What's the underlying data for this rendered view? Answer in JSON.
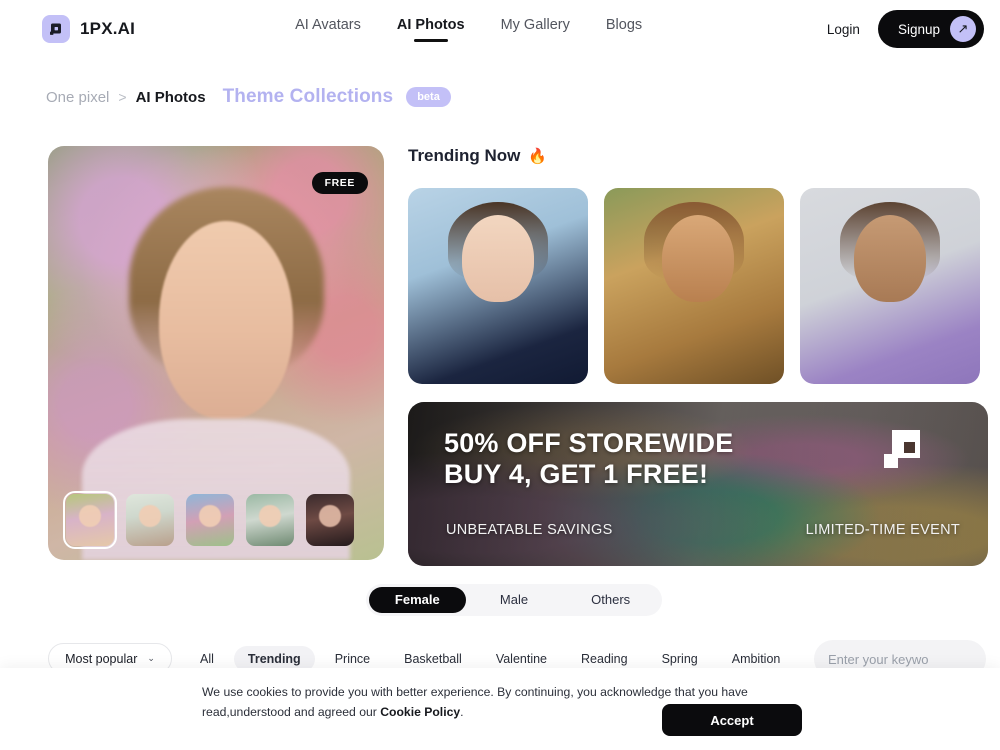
{
  "header": {
    "brand_name": "1PX.AI",
    "nav": [
      {
        "label": "AI Avatars",
        "active": false
      },
      {
        "label": "AI Photos",
        "active": true
      },
      {
        "label": "My Gallery",
        "active": false
      },
      {
        "label": "Blogs",
        "active": false
      }
    ],
    "login_label": "Login",
    "signup_label": "Signup",
    "signup_arrow": "↗",
    "accent_color": "#c3c0f7",
    "dark_color": "#0b0b0d"
  },
  "breadcrumb": {
    "root": "One pixel",
    "separator": ">",
    "current": "AI Photos",
    "theme_title": "Theme Collections",
    "beta_label": "beta"
  },
  "hero": {
    "badge": "FREE",
    "thumbnails": [
      {
        "name": "thumb-1",
        "selected": true
      },
      {
        "name": "thumb-2",
        "selected": false
      },
      {
        "name": "thumb-3",
        "selected": false
      },
      {
        "name": "thumb-4",
        "selected": false
      },
      {
        "name": "thumb-5",
        "selected": false
      }
    ]
  },
  "trending": {
    "title": "Trending Now",
    "flame_icon": "🔥",
    "cards": [
      {
        "name": "trending-card-blue"
      },
      {
        "name": "trending-card-golden"
      },
      {
        "name": "trending-card-lilac"
      }
    ]
  },
  "promo": {
    "headline_line1": "50% OFF STOREWIDE",
    "headline_line2": "BUY 4, GET 1 FREE!",
    "sub_left": "UNBEATABLE SAVINGS",
    "sub_right": "LIMITED-TIME EVENT"
  },
  "gender_toggle": {
    "options": [
      {
        "label": "Female",
        "active": true
      },
      {
        "label": "Male",
        "active": false
      },
      {
        "label": "Others",
        "active": false
      }
    ]
  },
  "filters": {
    "sort_value": "Most popular",
    "sort_chevron": "⌄",
    "chips": [
      {
        "label": "All",
        "active": false
      },
      {
        "label": "Trending",
        "active": true
      },
      {
        "label": "Prince",
        "active": false
      },
      {
        "label": "Basketball",
        "active": false
      },
      {
        "label": "Valentine",
        "active": false
      },
      {
        "label": "Reading",
        "active": false
      },
      {
        "label": "Spring",
        "active": false
      },
      {
        "label": "Ambition",
        "active": false
      }
    ]
  },
  "search": {
    "placeholder": "Enter your keywo",
    "value": "",
    "icon": "search-icon"
  },
  "cookie": {
    "text_part1": "We use cookies to provide you with better experience. By continuing, you acknowledge that you have read,understood and agreed our ",
    "link_label": "Cookie Policy",
    "text_part2": ".",
    "accept_label": "Accept"
  }
}
